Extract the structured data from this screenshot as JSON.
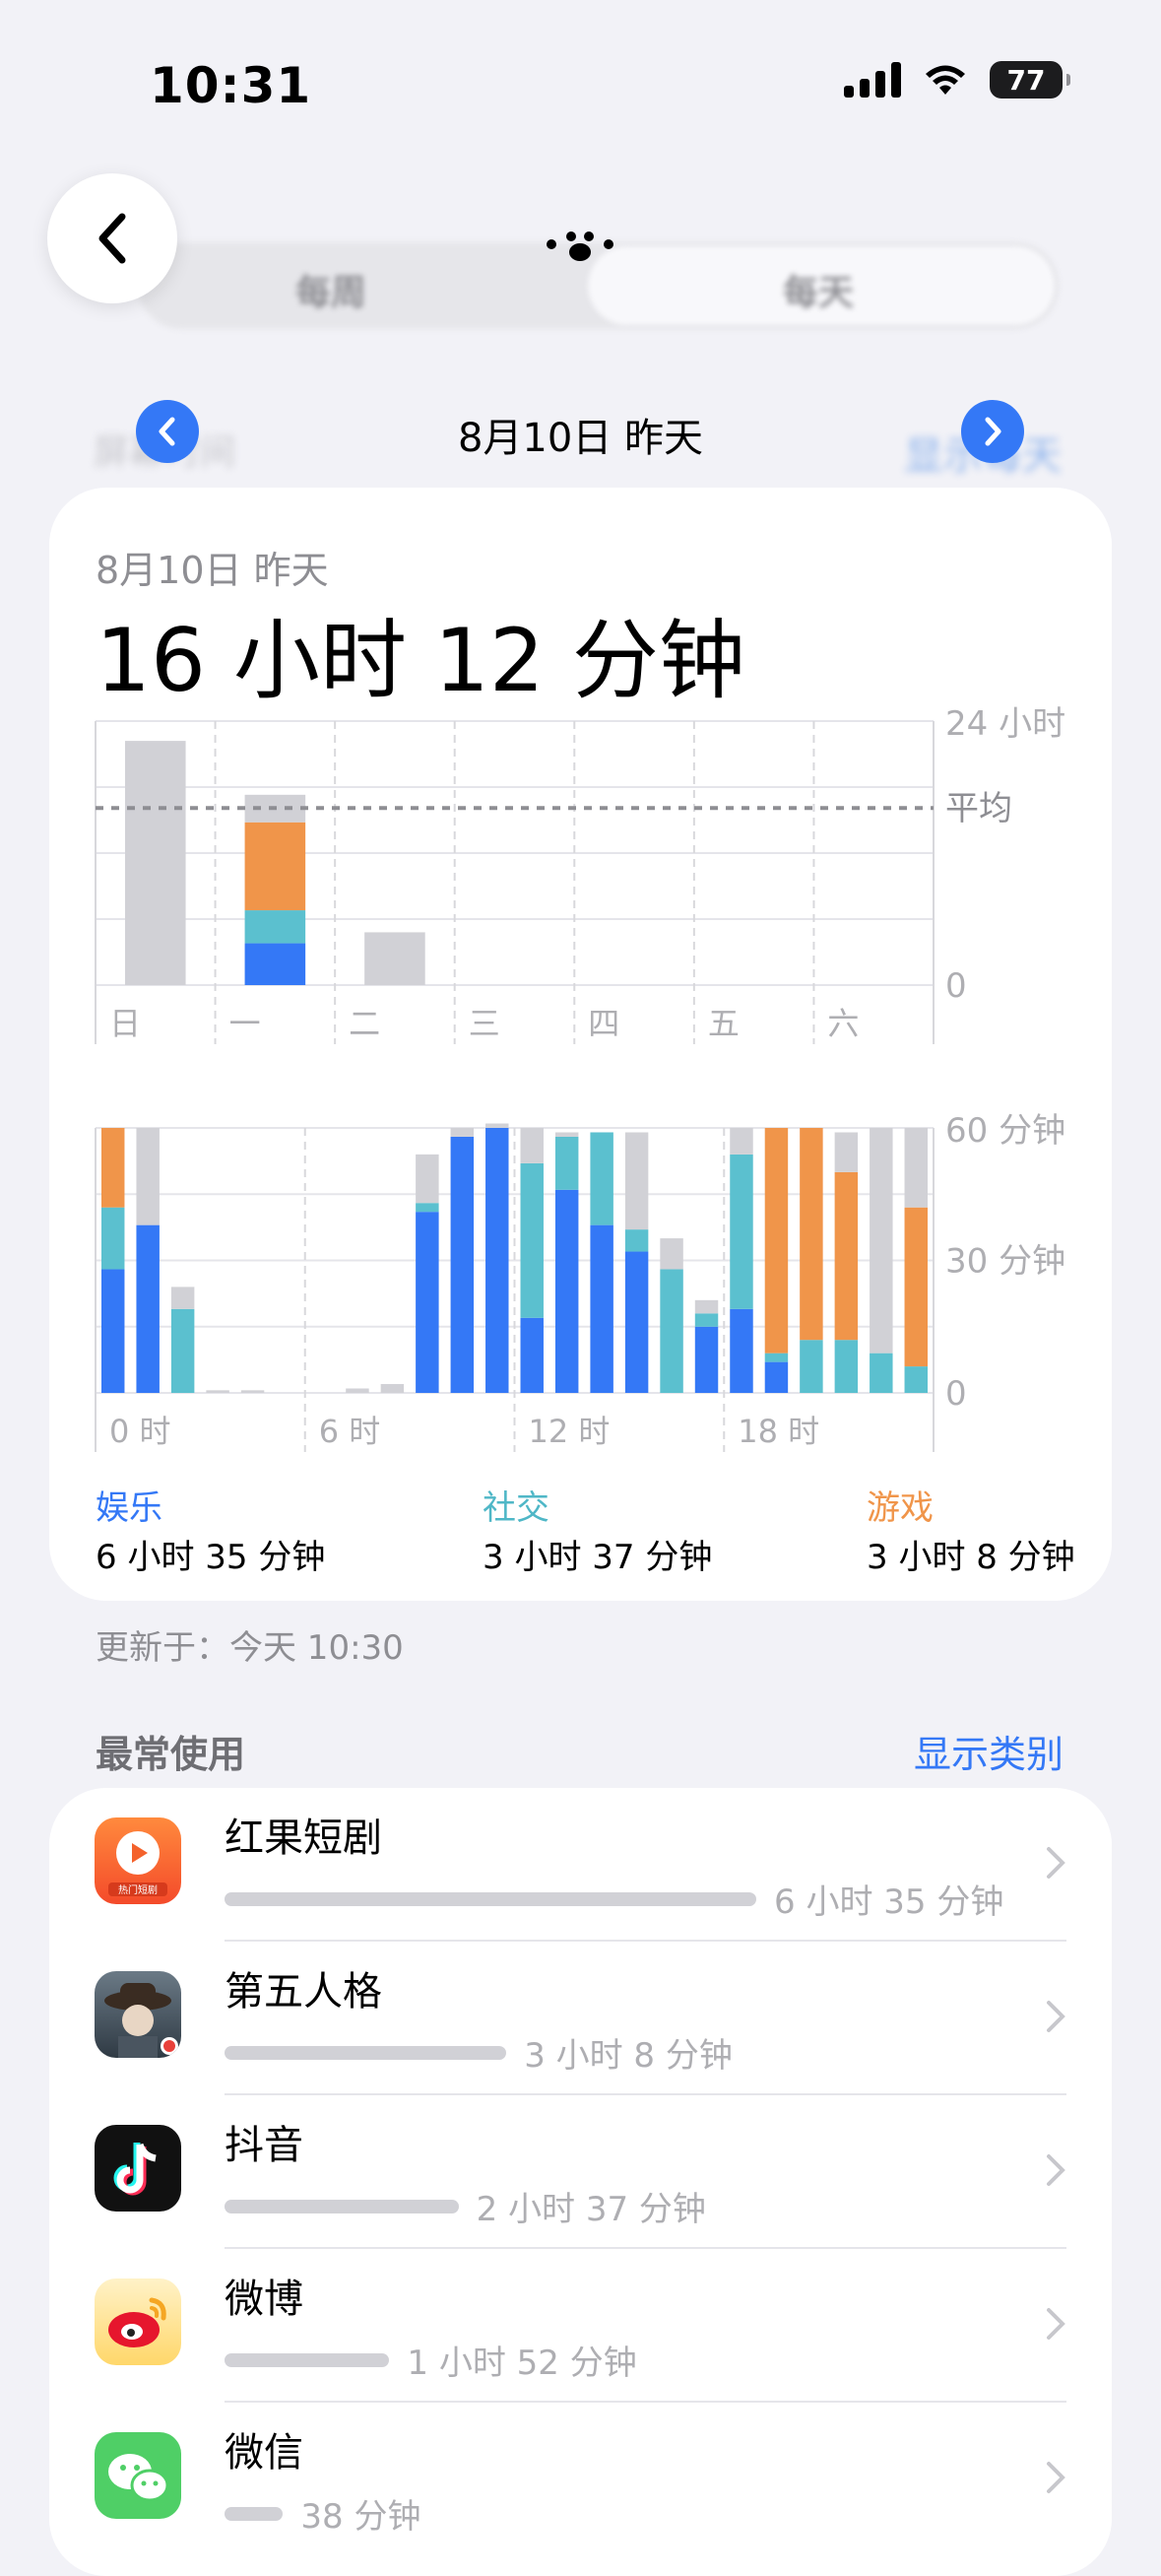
{
  "status": {
    "time": "10:31",
    "battery": "77"
  },
  "header": {
    "segments": [
      "每周",
      "每天"
    ],
    "ghost_left": "屏幕时间",
    "ghost_right": "显示每天",
    "date_title": "8月10日 昨天"
  },
  "card": {
    "date": "8月10日 昨天",
    "total": "16 小时 12 分钟",
    "categories": [
      {
        "label": "娱乐",
        "value": "6 小时 35 分钟"
      },
      {
        "label": "社交",
        "value": "3 小时 37 分钟"
      },
      {
        "label": "游戏",
        "value": "3 小时 8 分钟"
      }
    ]
  },
  "colors": {
    "entertainment": "#3478f6",
    "social": "#5bc0cf",
    "games": "#f0954a",
    "other": "#d1d1d6",
    "accent": "#3478f6"
  },
  "chart_data": [
    {
      "type": "bar",
      "name": "weekly",
      "categories": [
        "日",
        "一",
        "二",
        "三",
        "四",
        "五",
        "六"
      ],
      "y_ticks": [
        "24 小时",
        "平均",
        "0"
      ],
      "ylim": [
        0,
        24
      ],
      "average": 16.1,
      "series": [
        {
          "name": "娱乐",
          "values": [
            0,
            3.8,
            0,
            0,
            0,
            0,
            0
          ]
        },
        {
          "name": "社交",
          "values": [
            0,
            3.0,
            0,
            0,
            0,
            0,
            0
          ]
        },
        {
          "name": "游戏",
          "values": [
            0,
            8.0,
            0,
            0,
            0,
            0,
            0
          ]
        },
        {
          "name": "其他",
          "values": [
            22.2,
            2.5,
            4.8,
            0,
            0,
            0,
            0
          ]
        }
      ]
    },
    {
      "type": "bar",
      "name": "hourly",
      "x_ticks": [
        "0 时",
        "6 时",
        "12 时",
        "18 时"
      ],
      "y_ticks": [
        "60 分钟",
        "30 分钟",
        "0"
      ],
      "ylim": [
        0,
        60
      ],
      "x": [
        0,
        1,
        2,
        3,
        4,
        5,
        6,
        7,
        8,
        9,
        10,
        11,
        12,
        13,
        14,
        15,
        16,
        17,
        18,
        19,
        20,
        21,
        22,
        23
      ],
      "series": [
        {
          "name": "娱乐",
          "values": [
            28,
            38,
            0,
            0,
            0,
            0,
            0,
            0,
            0,
            41,
            58,
            60,
            17,
            46,
            38,
            32,
            0,
            15,
            19,
            7,
            0,
            0,
            0,
            0
          ]
        },
        {
          "name": "社交",
          "values": [
            14,
            0,
            19,
            0,
            0,
            0,
            0,
            0,
            0,
            2,
            0,
            0,
            35,
            12,
            21,
            5,
            28,
            3,
            35,
            2,
            12,
            12,
            9,
            6
          ]
        },
        {
          "name": "游戏",
          "values": [
            18,
            0,
            0,
            0,
            0,
            0,
            0,
            0,
            0,
            0,
            0,
            0,
            0,
            0,
            0,
            0,
            0,
            0,
            0,
            51,
            48,
            38,
            0,
            36
          ]
        },
        {
          "name": "其他",
          "values": [
            0,
            22,
            5,
            0.6,
            0.6,
            0,
            0,
            1,
            2,
            11,
            2,
            1,
            8,
            1,
            0,
            22,
            7,
            3,
            6,
            0,
            0,
            9,
            51,
            18
          ]
        }
      ]
    }
  ],
  "updated": "更新于：今天 10:30",
  "section": {
    "title": "最常使用",
    "link": "显示类别"
  },
  "apps": [
    {
      "name": "红果短剧",
      "duration": "6 小时 35 分钟",
      "ratio": 1.0,
      "icon": "hongguo-app-icon",
      "icon_text": "热门短剧"
    },
    {
      "name": "第五人格",
      "duration": "3 小时 8 分钟",
      "ratio": 0.53,
      "icon": "identity-v-app-icon"
    },
    {
      "name": "抖音",
      "duration": "2 小时 37 分钟",
      "ratio": 0.44,
      "icon": "douyin-app-icon"
    },
    {
      "name": "微博",
      "duration": "1 小时 52 分钟",
      "ratio": 0.31,
      "icon": "weibo-app-icon"
    },
    {
      "name": "微信",
      "duration": "38 分钟",
      "ratio": 0.11,
      "icon": "wechat-app-icon"
    }
  ]
}
